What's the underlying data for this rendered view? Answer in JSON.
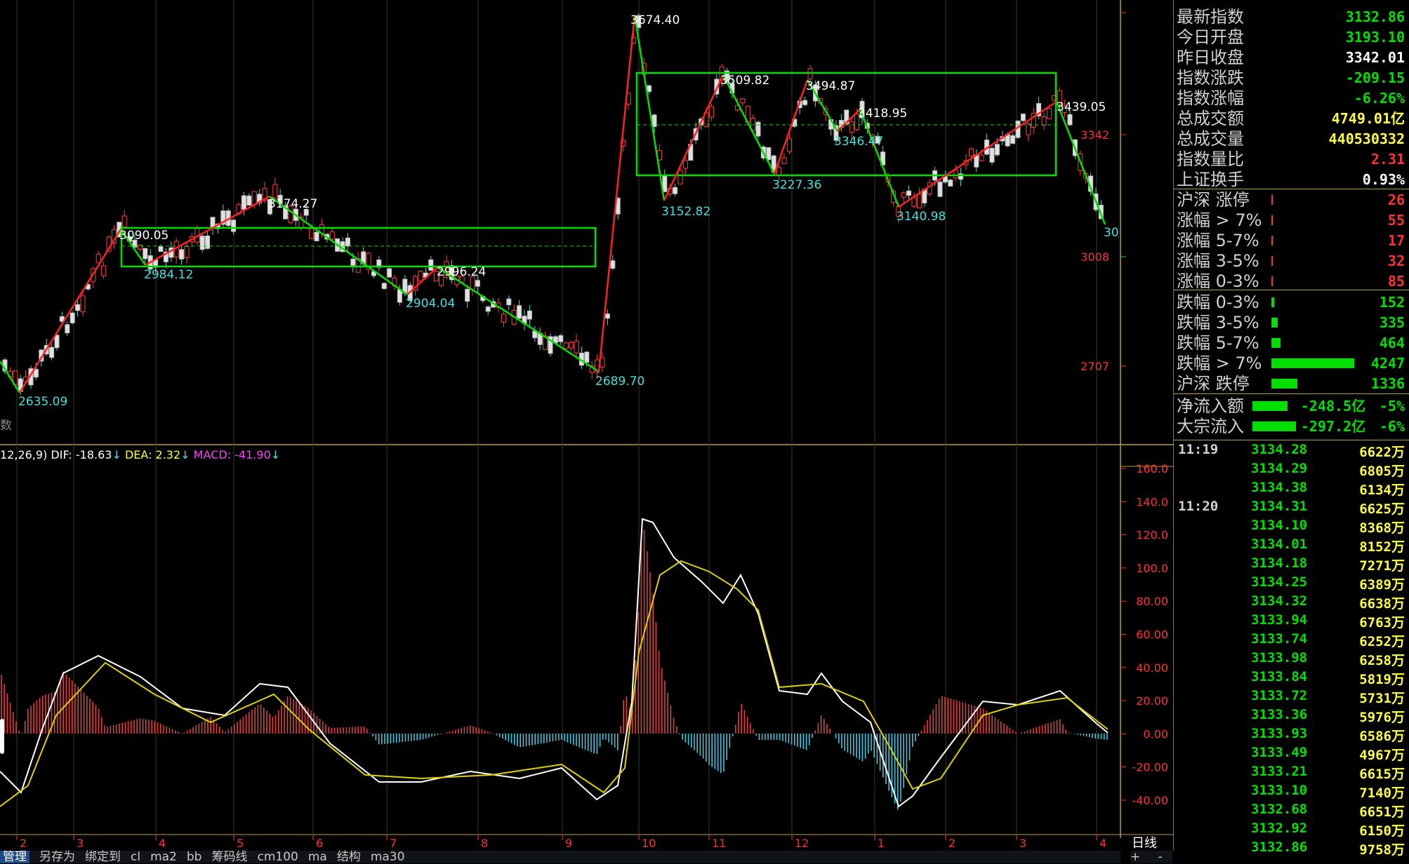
{
  "main_chart": {
    "price_axis": [
      "3342",
      "3008",
      "2707"
    ],
    "price_labels": [
      "3674.40",
      "3509.82",
      "3494.87",
      "3418.95",
      "3439.05",
      "3346.47",
      "3227.36",
      "3152.82",
      "3140.98",
      "3174.27",
      "3090.05",
      "2984.12",
      "2996.24",
      "2904.04",
      "2689.70",
      "2635.09",
      "30"
    ],
    "left_stub": "数"
  },
  "macd": {
    "header_params": "12,26,9)",
    "dif": "DIF: -18.63",
    "dea": "DEA: 2.32",
    "macd": "MACD: -41.90",
    "arrow": "↓",
    "yaxis": [
      "160.0",
      "140.0",
      "120.0",
      "100.0",
      "80.00",
      "60.00",
      "40.00",
      "20.00",
      "0.00",
      "-20.00",
      "-40.00"
    ]
  },
  "x_axis": {
    "months": [
      "2",
      "3",
      "4",
      "5",
      "6",
      "7",
      "8",
      "9",
      "10",
      "11",
      "12",
      "1",
      "2",
      "3",
      "4"
    ],
    "period": "日线"
  },
  "toolbar": [
    "管理",
    "另存为",
    "绑定到",
    "cl",
    "ma2",
    "bb",
    "筹码线",
    "cm100",
    "ma",
    "结构",
    "ma30"
  ],
  "toolbar_right": "+ -",
  "panel": {
    "index": [
      {
        "label": "最新指数",
        "value": "3132.86",
        "color": "#00e000"
      },
      {
        "label": "今日开盘",
        "value": "3193.10",
        "color": "#00e000"
      },
      {
        "label": "昨日收盘",
        "value": "3342.01",
        "color": "#ffffff"
      },
      {
        "label": "指数涨跌",
        "value": "-209.15",
        "color": "#00e000"
      },
      {
        "label": "指数涨幅",
        "value": "-6.26%",
        "color": "#00e000"
      },
      {
        "label": "总成交额",
        "value": "4749.01亿",
        "color": "#ffff40"
      },
      {
        "label": "总成交量",
        "value": "440530332",
        "color": "#ffff40"
      },
      {
        "label": "指数量比",
        "value": "2.31",
        "color": "#ff3030"
      },
      {
        "label": "上证换手",
        "value": "0.93%",
        "color": "#ffffff"
      }
    ],
    "up": [
      {
        "label": "沪深 涨停",
        "value": "26"
      },
      {
        "label": "涨幅 > 7%",
        "value": "55"
      },
      {
        "label": "涨幅 5-7%",
        "value": "17"
      },
      {
        "label": "涨幅 3-5%",
        "value": "32"
      },
      {
        "label": "涨幅 0-3%",
        "value": "85"
      }
    ],
    "down": [
      {
        "label": "跌幅 0-3%",
        "value": "152",
        "bar": 0.036
      },
      {
        "label": "跌幅 3-5%",
        "value": "335",
        "bar": 0.079
      },
      {
        "label": "跌幅 5-7%",
        "value": "464",
        "bar": 0.11
      },
      {
        "label": "跌幅 > 7%",
        "value": "4247",
        "bar": 1.0
      },
      {
        "label": "沪深 跌停",
        "value": "1336",
        "bar": 0.31
      }
    ],
    "flow": [
      {
        "label": "净流入额",
        "amount": "-248.5亿",
        "pct": "-5%"
      },
      {
        "label": "大宗流入",
        "amount": "-297.2亿",
        "pct": "-6%"
      }
    ],
    "ticks": [
      {
        "time": "11:19",
        "price": "3134.28",
        "vol": "6622万"
      },
      {
        "time": "",
        "price": "3134.29",
        "vol": "6805万"
      },
      {
        "time": "",
        "price": "3134.38",
        "vol": "6134万"
      },
      {
        "time": "11:20",
        "price": "3134.31",
        "vol": "6625万"
      },
      {
        "time": "",
        "price": "3134.10",
        "vol": "8368万"
      },
      {
        "time": "",
        "price": "3134.01",
        "vol": "8152万"
      },
      {
        "time": "",
        "price": "3134.18",
        "vol": "7271万"
      },
      {
        "time": "",
        "price": "3134.25",
        "vol": "6389万"
      },
      {
        "time": "",
        "price": "3134.32",
        "vol": "6638万"
      },
      {
        "time": "",
        "price": "3133.94",
        "vol": "6763万"
      },
      {
        "time": "",
        "price": "3133.74",
        "vol": "6252万"
      },
      {
        "time": "",
        "price": "3133.98",
        "vol": "6258万"
      },
      {
        "time": "",
        "price": "3133.84",
        "vol": "5819万"
      },
      {
        "time": "",
        "price": "3133.72",
        "vol": "5731万"
      },
      {
        "time": "",
        "price": "3133.36",
        "vol": "5976万"
      },
      {
        "time": "",
        "price": "3133.93",
        "vol": "6586万"
      },
      {
        "time": "",
        "price": "3133.49",
        "vol": "4967万"
      },
      {
        "time": "",
        "price": "3133.21",
        "vol": "6615万"
      },
      {
        "time": "",
        "price": "3133.10",
        "vol": "7140万"
      },
      {
        "time": "",
        "price": "3132.68",
        "vol": "6651万"
      },
      {
        "time": "",
        "price": "3132.92",
        "vol": "6150万"
      },
      {
        "time": "",
        "price": "3132.86",
        "vol": "9758万"
      }
    ]
  }
}
